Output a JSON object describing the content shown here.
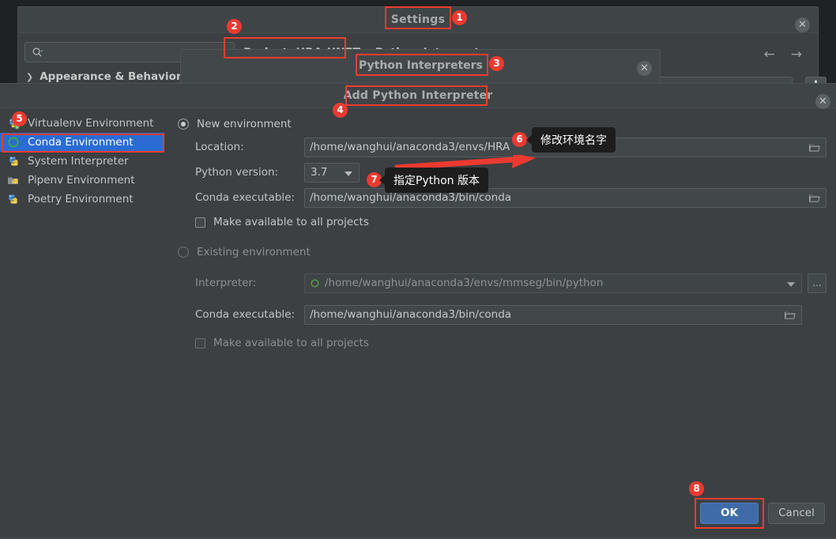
{
  "settings_window": {
    "title": "Settings",
    "close_icon": "close-circle-icon",
    "search": {
      "placeholder": "",
      "value": "",
      "icon": "search-icon"
    },
    "tree_item": "Appearance & Behavior",
    "breadcrumb": {
      "project": "Project: HRA-UNET",
      "separator": "›",
      "page": "Python Interpreter",
      "page_icon": "module-box-icon"
    },
    "nav": {
      "back_icon": "arrow-left-icon",
      "forward_icon": "arrow-right-icon"
    },
    "interpreter_select": {
      "value": "",
      "caret_icon": "chevron-down-icon"
    },
    "gear_icon": "gear-icon"
  },
  "interpreters_window": {
    "title": "Python Interpreters",
    "close_icon": "close-circle-icon"
  },
  "add_interpreter_dialog": {
    "title": "Add Python Interpreter",
    "close_icon": "close-circle-icon",
    "env_list": [
      {
        "label": "Virtualenv Environment",
        "icon": "virtualenv-icon",
        "selected": false
      },
      {
        "label": "Conda Environment",
        "icon": "conda-icon",
        "selected": true
      },
      {
        "label": "System Interpreter",
        "icon": "python-icon",
        "selected": false
      },
      {
        "label": "Pipenv Environment",
        "icon": "pipenv-icon",
        "selected": false
      },
      {
        "label": "Poetry Environment",
        "icon": "poetry-icon",
        "selected": false
      }
    ],
    "new_environment": {
      "radio_label": "New environment",
      "selected": true,
      "location_label": "Location:",
      "location_value": "/home/wanghui/anaconda3/envs/HRA",
      "python_version_label": "Python version:",
      "python_version_value": "3.7",
      "conda_executable_label": "Conda executable:",
      "conda_executable_value": "/home/wanghui/anaconda3/bin/conda",
      "make_available_label": "Make available to all projects",
      "make_available_checked": false,
      "browse_icon": "folder-icon"
    },
    "existing_environment": {
      "radio_label": "Existing environment",
      "selected": false,
      "interpreter_label": "Interpreter:",
      "interpreter_value": "/home/wanghui/anaconda3/envs/mmseg/bin/python",
      "interpreter_icon": "conda-icon",
      "more_button_label": "...",
      "conda_executable_label": "Conda executable:",
      "conda_executable_value": "/home/wanghui/anaconda3/bin/conda",
      "make_available_label": "Make available to all projects",
      "make_available_checked": false,
      "browse_icon": "folder-icon"
    },
    "ok_label": "OK",
    "cancel_label": "Cancel"
  },
  "annotations": {
    "accent_color": "#ec3a30",
    "badges": [
      {
        "n": "1",
        "target": "settings-title"
      },
      {
        "n": "2",
        "target": "breadcrumb-project"
      },
      {
        "n": "3",
        "target": "interpreters-title"
      },
      {
        "n": "4",
        "target": "add-interpreter-title"
      },
      {
        "n": "5",
        "target": "conda-environment-item"
      },
      {
        "n": "6",
        "target": "location-field"
      },
      {
        "n": "7",
        "target": "python-version-select"
      },
      {
        "n": "8",
        "target": "ok-button"
      }
    ],
    "tooltips": [
      {
        "text": "修改环境名字",
        "target": "location-field"
      },
      {
        "text": "指定Python 版本",
        "target": "python-version-select"
      }
    ]
  }
}
